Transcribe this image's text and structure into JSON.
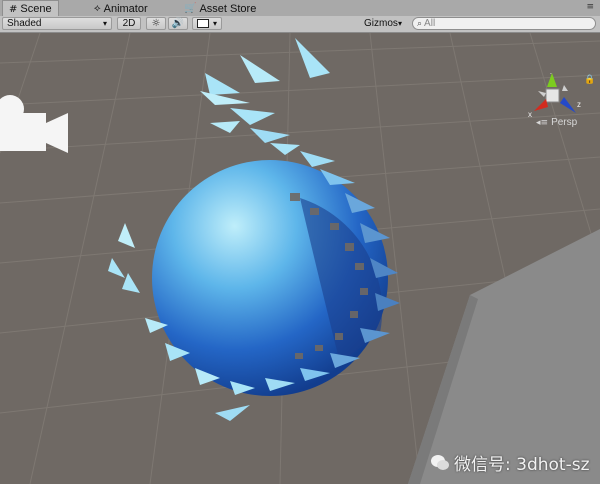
{
  "tabs": [
    {
      "label": "Scene",
      "icon": "scene-icon",
      "active": true
    },
    {
      "label": "Animator",
      "icon": "animator-icon",
      "active": false
    },
    {
      "label": "Asset Store",
      "icon": "asset-store-icon",
      "active": false
    }
  ],
  "toolbar": {
    "shading_mode": "Shaded",
    "mode_2d": "2D",
    "lighting_icon": "sun-icon",
    "audio_icon": "speaker-icon",
    "effects_icon": "image-icon",
    "gizmos_label": "Gizmos",
    "search_placeholder": "All"
  },
  "gizmo": {
    "x_label": "x",
    "y_label": "y",
    "z_label": "z",
    "projection_label": "Persp"
  },
  "watermark": {
    "text": "微信号: 3dhot-sz",
    "icon": "wechat-icon"
  },
  "colors": {
    "background": "#6f6964",
    "grid": "#7d7771",
    "sphere_light": "#a9e4f7",
    "sphere_dark": "#1e56b8",
    "axis_x": "#d32b1f",
    "axis_y": "#7ccc1f",
    "axis_z": "#2549c8"
  }
}
